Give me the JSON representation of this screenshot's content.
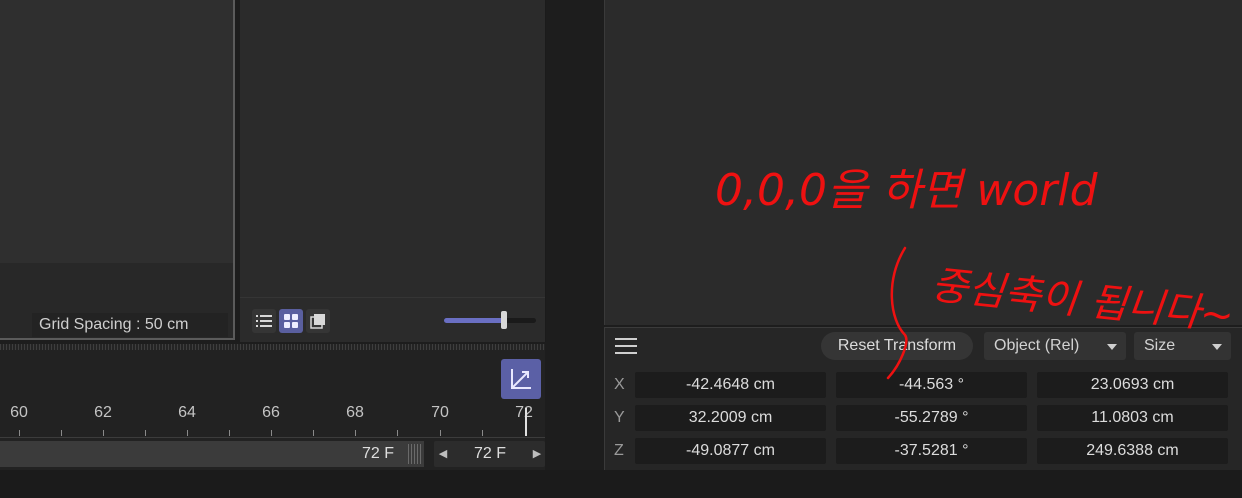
{
  "viewport": {
    "grid_spacing": "Grid Spacing : 50 cm"
  },
  "timeline": {
    "ticks": [
      "60",
      "62",
      "64",
      "66",
      "68",
      "70",
      "72"
    ],
    "end_frame": "72 F",
    "current_frame": "72 F"
  },
  "coordinates": {
    "reset_button": "Reset Transform",
    "mode_dropdown": "Object (Rel)",
    "size_dropdown": "Size",
    "rows": [
      {
        "axis": "X",
        "position": "-42.4648 cm",
        "rotation": "-44.563 °",
        "size": "23.0693 cm"
      },
      {
        "axis": "Y",
        "position": "32.2009 cm",
        "rotation": "-55.2789 °",
        "size": "11.0803 cm"
      },
      {
        "axis": "Z",
        "position": "-49.0877 cm",
        "rotation": "-37.5281 °",
        "size": "249.6388 cm"
      }
    ]
  },
  "annotation": {
    "line1": "0,0,0을 하면 world",
    "line2": "중심축이 됩니다~",
    "color": "#ee1111"
  }
}
